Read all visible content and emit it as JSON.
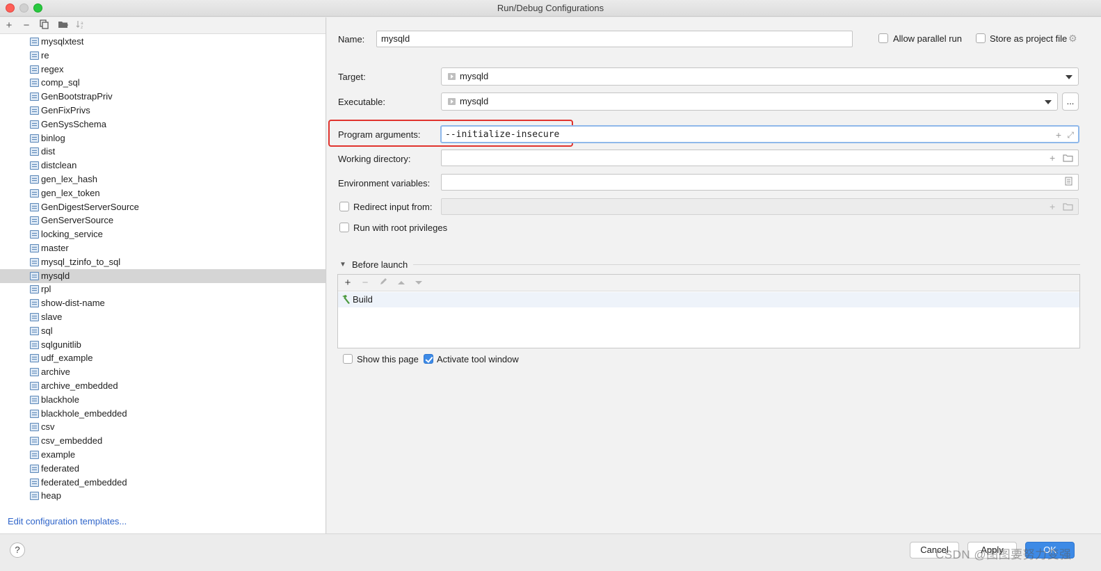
{
  "window": {
    "title": "Run/Debug Configurations"
  },
  "left_toolbar": {
    "icons": [
      "add-icon",
      "remove-icon",
      "copy-icon",
      "folder-icon",
      "sort-icon"
    ]
  },
  "tree": {
    "selected": "mysqld",
    "items": [
      "mysqlxtest",
      "re",
      "regex",
      "comp_sql",
      "GenBootstrapPriv",
      "GenFixPrivs",
      "GenSysSchema",
      "binlog",
      "dist",
      "distclean",
      "gen_lex_hash",
      "gen_lex_token",
      "GenDigestServerSource",
      "GenServerSource",
      "locking_service",
      "master",
      "mysql_tzinfo_to_sql",
      "mysqld",
      "rpl",
      "show-dist-name",
      "slave",
      "sql",
      "sqlgunitlib",
      "udf_example",
      "archive",
      "archive_embedded",
      "blackhole",
      "blackhole_embedded",
      "csv",
      "csv_embedded",
      "example",
      "federated",
      "federated_embedded",
      "heap"
    ]
  },
  "edit_templates_link": "Edit configuration templates...",
  "form": {
    "name_label": "Name:",
    "name_value": "mysqld",
    "allow_parallel_label": "Allow parallel run",
    "store_project_label": "Store as project file",
    "target_label": "Target:",
    "target_value": "mysqld",
    "executable_label": "Executable:",
    "executable_value": "mysqld",
    "browse_label": "...",
    "program_args_label": "Program arguments:",
    "program_args_value": "--initialize-insecure",
    "working_dir_label": "Working directory:",
    "working_dir_value": "",
    "env_vars_label": "Environment variables:",
    "env_vars_value": "",
    "redirect_label": "Redirect input from:",
    "redirect_value": "",
    "root_priv_label": "Run with root privileges"
  },
  "before_launch": {
    "title": "Before launch",
    "items": [
      {
        "label": "Build",
        "icon": "hammer-icon"
      }
    ]
  },
  "options": {
    "show_page_label": "Show this page",
    "show_page_checked": false,
    "activate_tool_label": "Activate tool window",
    "activate_tool_checked": true
  },
  "buttons": {
    "help": "?",
    "cancel": "Cancel",
    "apply": "Apply",
    "ok": "OK"
  },
  "watermark": "CSDN @图图要努力变强",
  "colors": {
    "accent": "#3d8ae6",
    "highlight": "#e0332d",
    "selection": "#d5d5d5",
    "link": "#2f65ca"
  }
}
